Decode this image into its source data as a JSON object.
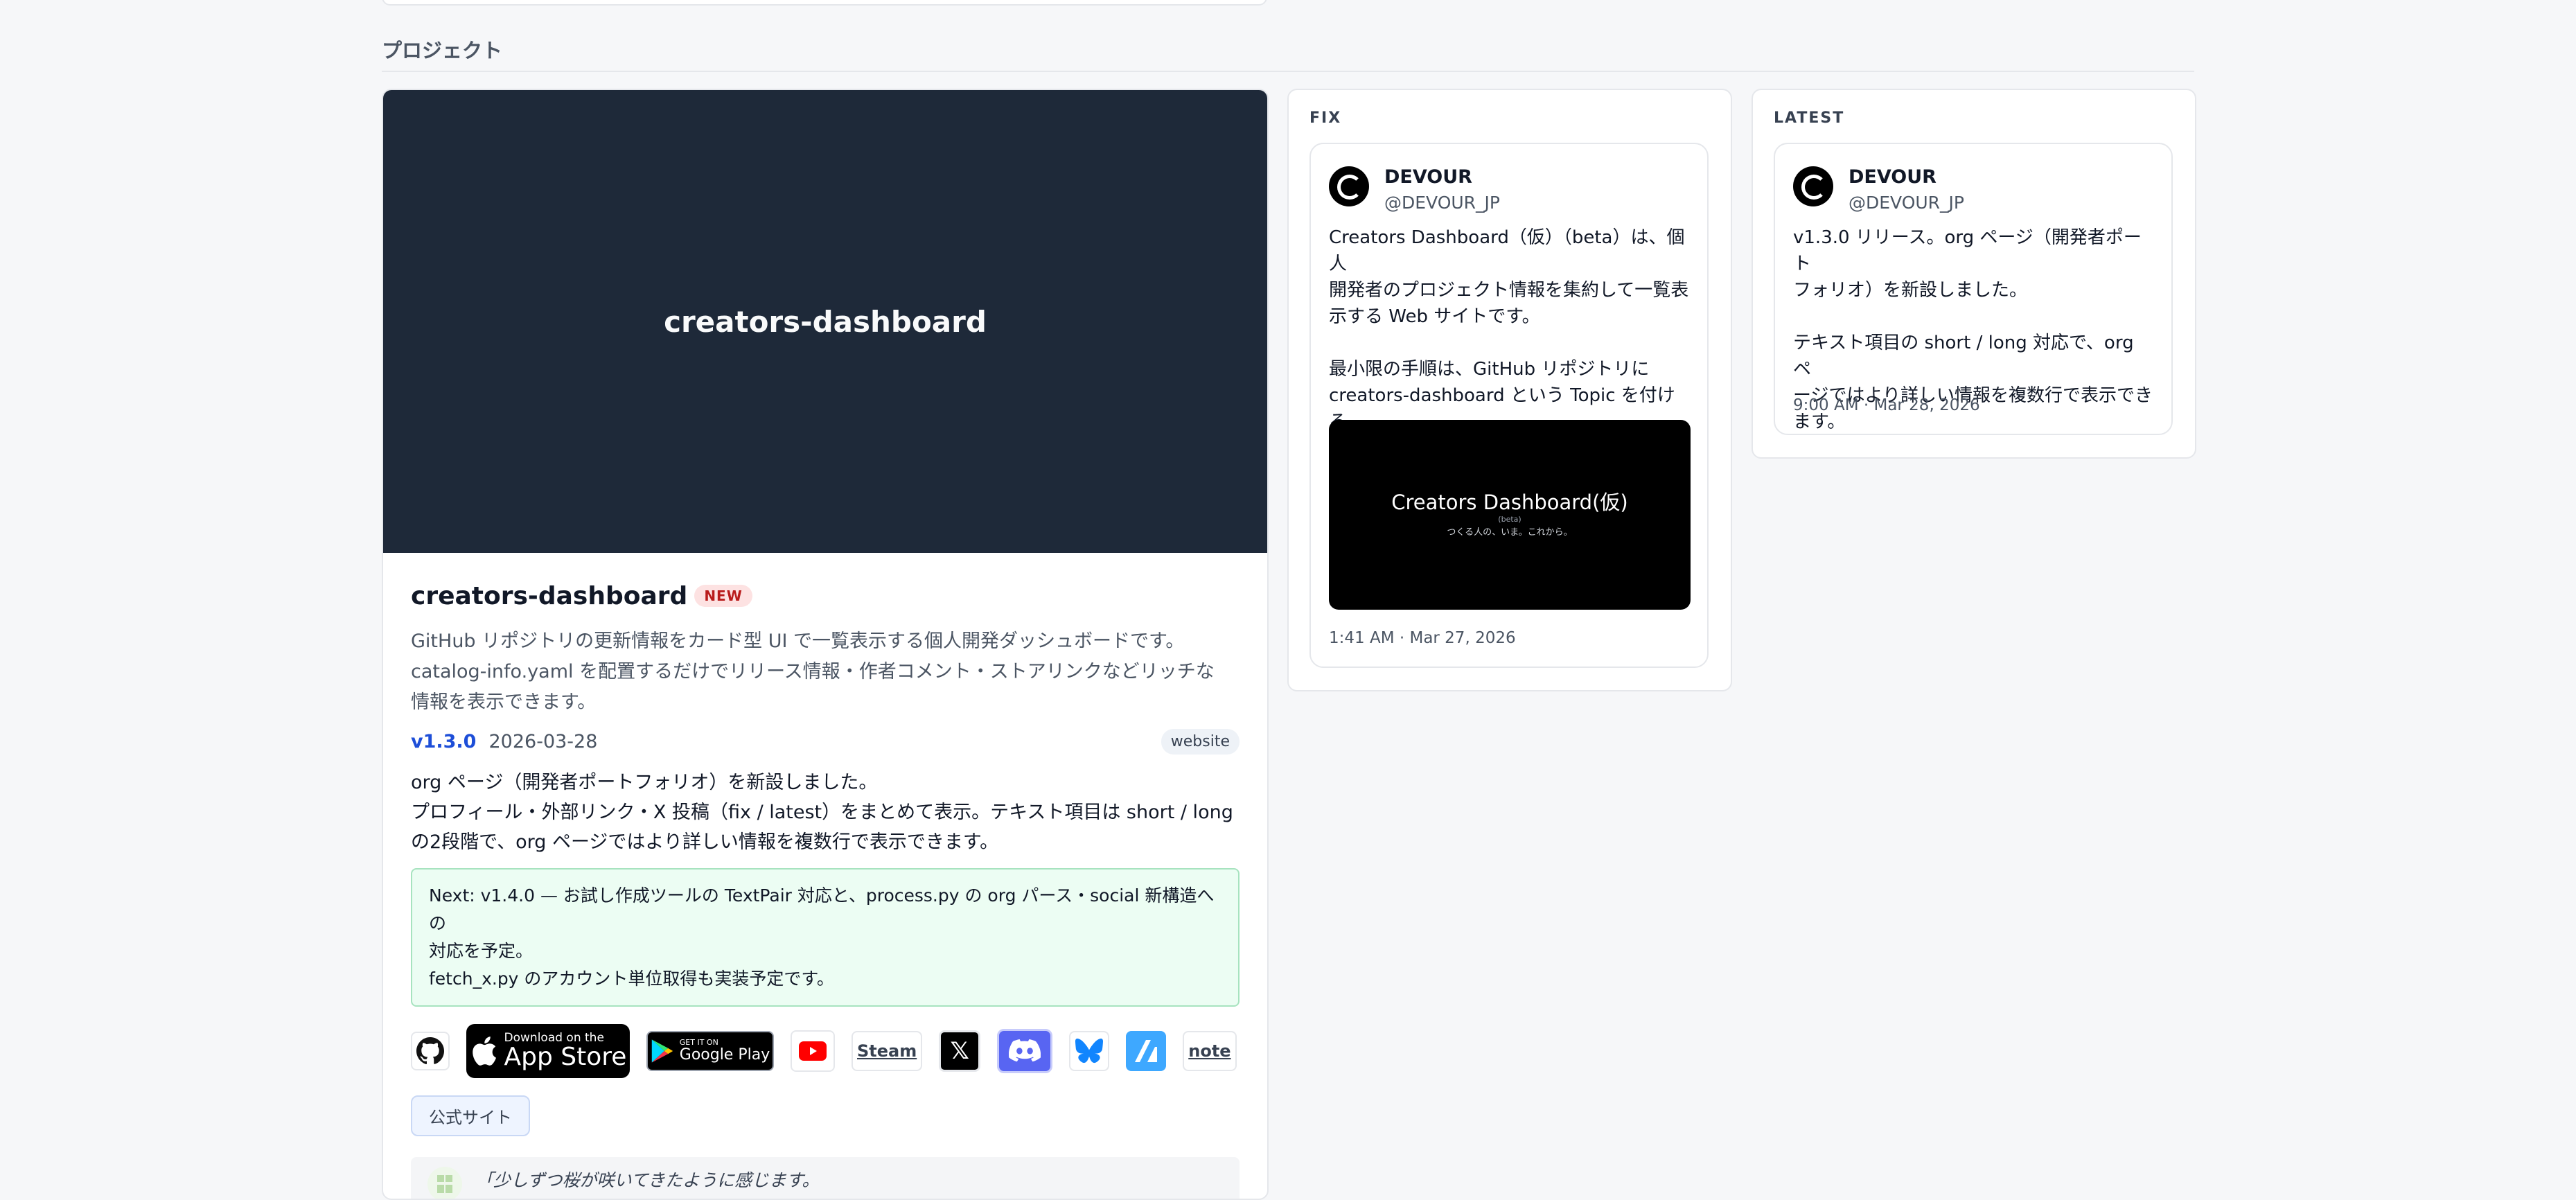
{
  "section": {
    "title": "プロジェクト"
  },
  "project": {
    "hero_title": "creators-dashboard",
    "name": "creators-dashboard",
    "badge": "NEW",
    "description": "GitHub リポジトリの更新情報をカード型 UI で一覧表示する個人開発ダッシュボードです。\ncatalog-info.yaml を配置するだけでリリース情報・作者コメント・ストアリンクなどリッチな\n情報を表示できます。",
    "version": "v1.3.0",
    "release_date": "2026-03-28",
    "tag": "website",
    "release_notes": "org ページ（開発者ポートフォリオ）を新設しました。\nプロフィール・外部リンク・X 投稿（fix / latest）をまとめて表示。テキスト項目は short / long\nの2段階で、org ページではより詳しい情報を複数行で表示できます。",
    "next_notice": "Next: v1.4.0 — お試し作成ツールの TextPair 対応と、process.py の org パース・social 新構造への\n対応を予定。\nfetch_x.py のアカウント単位取得も実装予定です。",
    "links": {
      "appstore_small": "Download on the",
      "appstore_big": "App Store",
      "googleplay_small": "GET IT ON",
      "googleplay_big": "Google Play",
      "steam": "Steam",
      "note": "note"
    },
    "official_site": "公式サイト",
    "comment": "「少しずつ桜が咲いてきたように感じます。\n開発の合間に近所を散歩するのが最近の楽しみです。」"
  },
  "fix": {
    "label": "FIX",
    "name": "DEVOUR",
    "handle": "@DEVOUR_JP",
    "text": "Creators Dashboard（仮）（beta）は、個人\n開発者のプロジェクト情報を集約して一覧表\n示する Web サイトです。\n\n最小限の手順は、GitHub リポジトリに\ncreators-dashboard という Topic を付ける\nだけ。",
    "image_title": "Creators Dashboard(仮)",
    "image_beta": "(beta)",
    "image_sub": "つくる人の、いま。これから。",
    "time": "1:41 AM · Mar 27, 2026"
  },
  "latest": {
    "label": "LATEST",
    "name": "DEVOUR",
    "handle": "@DEVOUR_JP",
    "text": "v1.3.0 リリース。org ページ（開発者ポート\nフォリオ）を新設しました。\n\nテキスト項目の short / long 対応で、org ペ\nージではより詳しい情報を複数行で表示でき\nます。",
    "time": "9:00 AM · Mar 28, 2026"
  }
}
